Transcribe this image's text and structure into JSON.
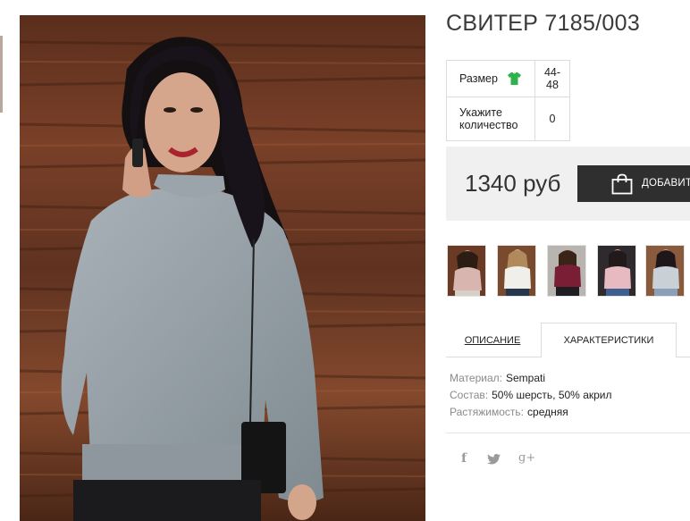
{
  "product": {
    "title": "СВИТЕР 7185/003",
    "image_alt": "woman in grey knitted sweater"
  },
  "options": {
    "size_label": "Размер",
    "size_value": "44-48",
    "size_icon": "tshirt-icon",
    "size_icon_color": "#2eb34a",
    "qty_label_line1": "Укажите",
    "qty_label_line2": "количество",
    "qty_value": "0"
  },
  "price": {
    "amount": "1340 руб",
    "add_button_label": "ДОБАВИТЬ",
    "add_button_icon": "shopping-bag-icon"
  },
  "thumbnails": [
    {
      "label": "pink sweater"
    },
    {
      "label": "white sweater"
    },
    {
      "label": "burgundy sweater"
    },
    {
      "label": "light pink sweater"
    },
    {
      "label": "light grey sweater"
    }
  ],
  "tabs": {
    "description": "ОПИСАНИЕ",
    "characteristics": "ХАРАКТЕРИСТИКИ",
    "active": "characteristics"
  },
  "characteristics": [
    {
      "key": "Материал:",
      "value": "Sempati"
    },
    {
      "key": "Состав:",
      "value": "50% шерсть, 50% акрил"
    },
    {
      "key": "Растяжимость:",
      "value": "средняя"
    }
  ],
  "social": {
    "facebook": "f",
    "twitter": "twitter-icon",
    "googleplus": "g+"
  },
  "colors": {
    "button_bg": "#2f2f2f",
    "price_box_bg": "#f0f0f0",
    "accent_green": "#2eb34a"
  }
}
